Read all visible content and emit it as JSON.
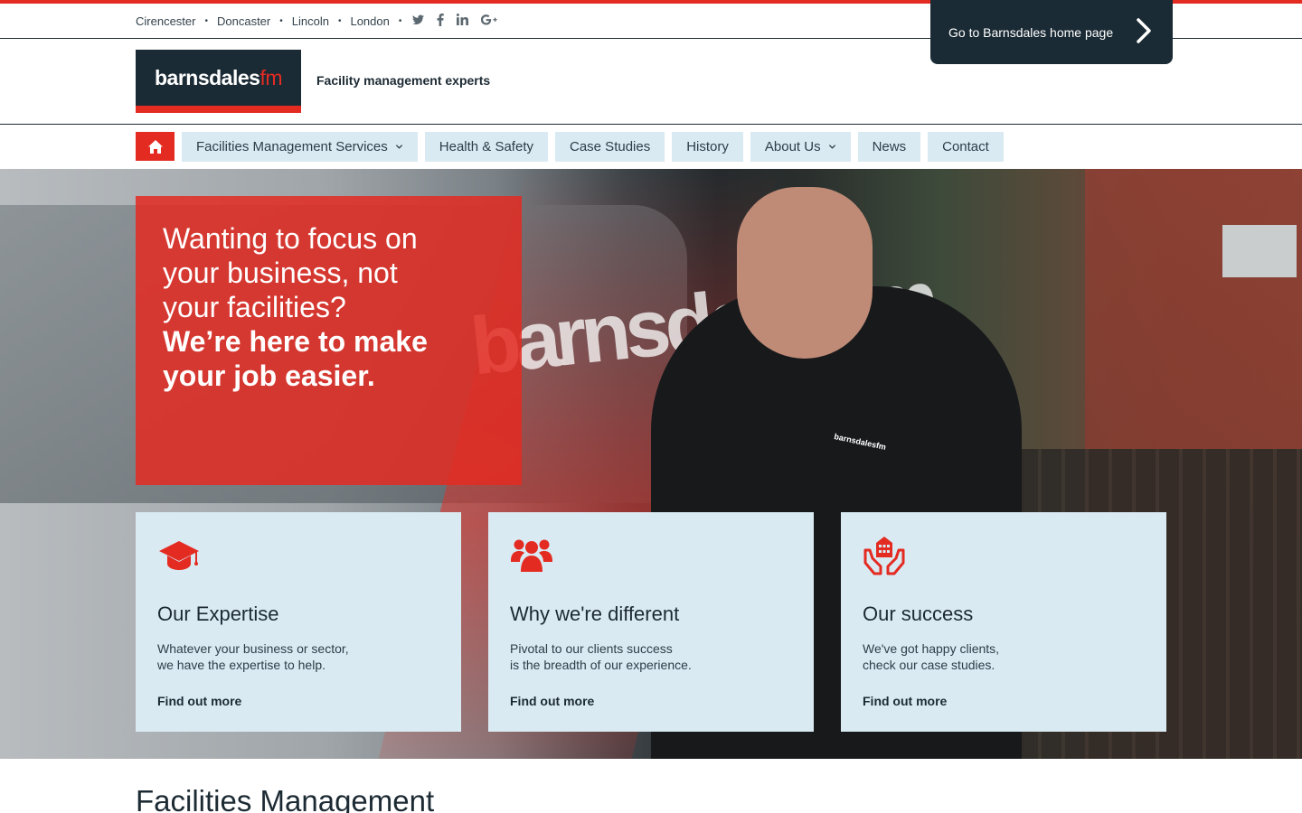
{
  "locations": [
    "Cirencester",
    "Doncaster",
    "Lincoln",
    "London"
  ],
  "separator": "•",
  "social": {
    "twitter": "twitter-icon",
    "facebook": "facebook-icon",
    "linkedin": "linkedin-icon",
    "googleplus": "google-plus-icon"
  },
  "home_link": {
    "label": "Go to Barnsdales home page"
  },
  "logo": {
    "brand": "barnsdales",
    "suffix": "fm"
  },
  "tagline": "Facility management experts",
  "nav": {
    "items": [
      {
        "label": "Facilities Management Services",
        "dropdown": true
      },
      {
        "label": "Health & Safety",
        "dropdown": false
      },
      {
        "label": "Case Studies",
        "dropdown": false
      },
      {
        "label": "History",
        "dropdown": false
      },
      {
        "label": "About Us",
        "dropdown": true
      },
      {
        "label": "News",
        "dropdown": false
      },
      {
        "label": "Contact",
        "dropdown": false
      }
    ]
  },
  "hero": {
    "line1": "Wanting to focus on",
    "line2": "your business, not",
    "line3": "your facilities?",
    "line4": "We’re here to make",
    "line5": "your job easier.",
    "van_lettering": "barnsdalesfm",
    "shirt_logo": "barnsdalesfm"
  },
  "cards": [
    {
      "icon": "graduation-cap-icon",
      "title": "Our Expertise",
      "desc1": "Whatever your business or sector,",
      "desc2": "we have the expertise to help.",
      "more": "Find out more"
    },
    {
      "icon": "users-icon",
      "title": "Why we're different",
      "desc1": "Pivotal to our clients success",
      "desc2": "is the breadth of our experience.",
      "more": "Find out more"
    },
    {
      "icon": "hands-building-icon",
      "title": "Our success",
      "desc1": "We've got happy clients,",
      "desc2": "check our case studies.",
      "more": "Find out more"
    }
  ],
  "section_title": "Facilities Management",
  "colors": {
    "accent": "#e32b22",
    "dark": "#1b2b35",
    "card_bg": "#daeaf3"
  }
}
